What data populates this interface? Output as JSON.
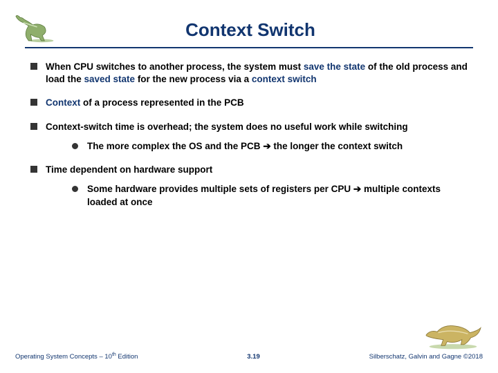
{
  "title": "Context Switch",
  "bullets": {
    "b1_pre": "When CPU switches to another process, the system must ",
    "b1_s1": "save the state",
    "b1_mid1": " of the old process and load the ",
    "b1_s2": "saved state",
    "b1_mid2": " for the new process via a ",
    "b1_s3": "context switch",
    "b2_s1": "Context",
    "b2_rest": " of a process represented in the PCB",
    "b3": "Context-switch time is overhead; the system does no useful work while switching",
    "b3a_pre": "The more complex the OS and the PCB ",
    "b3a_arrow": "➔",
    "b3a_post": " the longer the context switch",
    "b4": "Time dependent on hardware support",
    "b4a_pre": "Some hardware provides multiple sets of registers per CPU ",
    "b4a_arrow": "➔",
    "b4a_post": " multiple contexts loaded at once"
  },
  "footer": {
    "left_pre": "Operating System Concepts – 10",
    "left_sup": "th",
    "left_post": " Edition",
    "center": "3.19",
    "right": "Silberschatz, Galvin and Gagne ©2018"
  }
}
